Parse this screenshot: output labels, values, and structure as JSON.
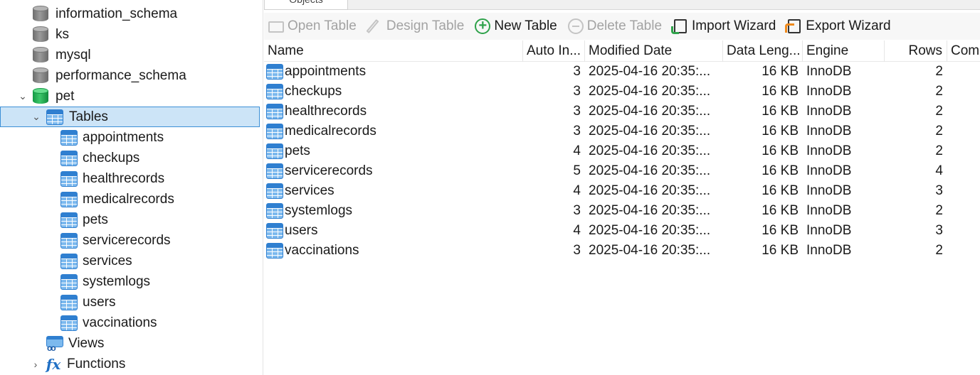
{
  "sidebar": {
    "databases": [
      {
        "name": "information_schema"
      },
      {
        "name": "ks"
      },
      {
        "name": "mysql"
      },
      {
        "name": "performance_schema"
      },
      {
        "name": "pet"
      }
    ],
    "tables_label": "Tables",
    "tables": [
      "appointments",
      "checkups",
      "healthrecords",
      "medicalrecords",
      "pets",
      "servicerecords",
      "services",
      "systemlogs",
      "users",
      "vaccinations"
    ],
    "views_label": "Views",
    "functions_label": "Functions"
  },
  "tab": {
    "label": "Objects"
  },
  "toolbar": {
    "open_table": "Open Table",
    "design_table": "Design Table",
    "new_table": "New Table",
    "delete_table": "Delete Table",
    "import_wizard": "Import Wizard",
    "export_wizard": "Export Wizard"
  },
  "grid": {
    "headers": {
      "name": "Name",
      "auto_inc": "Auto In...",
      "modified": "Modified Date",
      "data_length": "Data Leng...",
      "engine": "Engine",
      "rows": "Rows",
      "comment": "Com"
    },
    "rows": [
      {
        "name": "appointments",
        "auto_inc": "3",
        "modified": "2025-04-16 20:35:...",
        "data_length": "16 KB",
        "engine": "InnoDB",
        "rows": "2"
      },
      {
        "name": "checkups",
        "auto_inc": "3",
        "modified": "2025-04-16 20:35:...",
        "data_length": "16 KB",
        "engine": "InnoDB",
        "rows": "2"
      },
      {
        "name": "healthrecords",
        "auto_inc": "3",
        "modified": "2025-04-16 20:35:...",
        "data_length": "16 KB",
        "engine": "InnoDB",
        "rows": "2"
      },
      {
        "name": "medicalrecords",
        "auto_inc": "3",
        "modified": "2025-04-16 20:35:...",
        "data_length": "16 KB",
        "engine": "InnoDB",
        "rows": "2"
      },
      {
        "name": "pets",
        "auto_inc": "4",
        "modified": "2025-04-16 20:35:...",
        "data_length": "16 KB",
        "engine": "InnoDB",
        "rows": "2"
      },
      {
        "name": "servicerecords",
        "auto_inc": "5",
        "modified": "2025-04-16 20:35:...",
        "data_length": "16 KB",
        "engine": "InnoDB",
        "rows": "4"
      },
      {
        "name": "services",
        "auto_inc": "4",
        "modified": "2025-04-16 20:35:...",
        "data_length": "16 KB",
        "engine": "InnoDB",
        "rows": "3"
      },
      {
        "name": "systemlogs",
        "auto_inc": "3",
        "modified": "2025-04-16 20:35:...",
        "data_length": "16 KB",
        "engine": "InnoDB",
        "rows": "2"
      },
      {
        "name": "users",
        "auto_inc": "4",
        "modified": "2025-04-16 20:35:...",
        "data_length": "16 KB",
        "engine": "InnoDB",
        "rows": "3"
      },
      {
        "name": "vaccinations",
        "auto_inc": "3",
        "modified": "2025-04-16 20:35:...",
        "data_length": "16 KB",
        "engine": "InnoDB",
        "rows": "2"
      }
    ]
  },
  "colors": {
    "selection_bg": "#cce4f7",
    "selection_border": "#3c8fd6",
    "table_icon": "#2f7fd0",
    "db_active": "#1fae52",
    "db_inactive": "#8a8a8a"
  }
}
